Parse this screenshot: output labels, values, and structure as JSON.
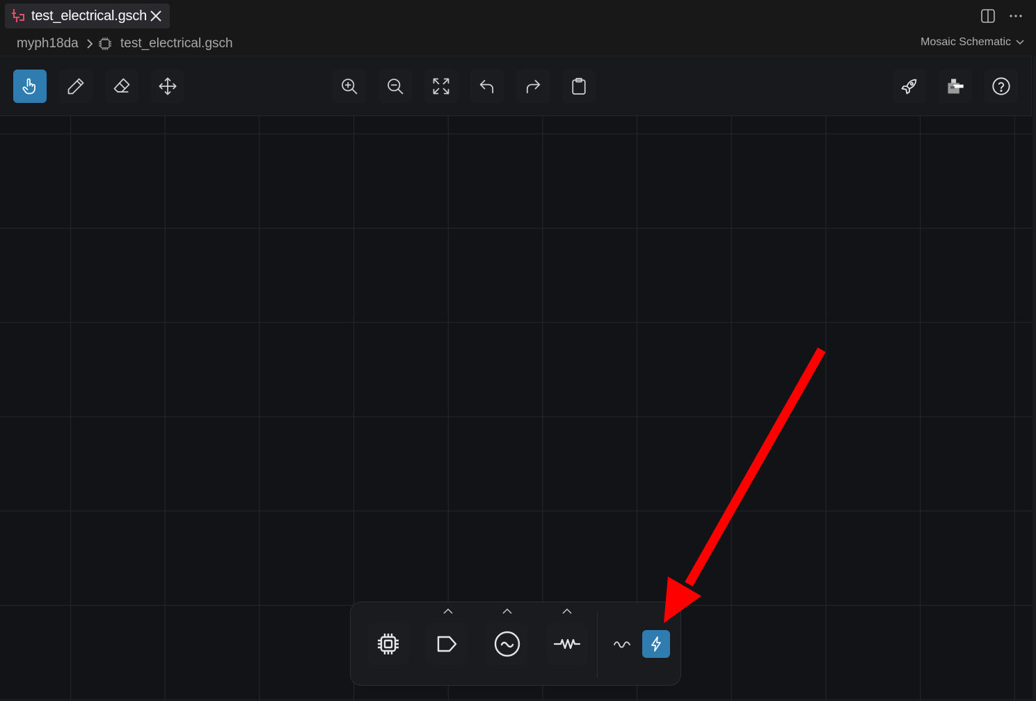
{
  "tab": {
    "title": "test_electrical.gsch",
    "icon": "schematic-icon",
    "accent": "#e0506a"
  },
  "breadcrumb": {
    "project": "myph18da",
    "file": "test_electrical.gsch"
  },
  "editor": {
    "mode_label": "Mosaic Schematic"
  },
  "toolbar": {
    "left": [
      {
        "name": "pointer-tool",
        "icon": "hand-pointer-icon",
        "active": true
      },
      {
        "name": "draw-tool",
        "icon": "pencil-icon",
        "active": false
      },
      {
        "name": "erase-tool",
        "icon": "eraser-icon",
        "active": false
      },
      {
        "name": "move-tool",
        "icon": "move-arrows-icon",
        "active": false
      }
    ],
    "center": [
      {
        "name": "zoom-in",
        "icon": "zoom-in-icon"
      },
      {
        "name": "zoom-out",
        "icon": "zoom-out-icon"
      },
      {
        "name": "fit-view",
        "icon": "fit-screen-icon"
      },
      {
        "name": "undo",
        "icon": "undo-icon"
      },
      {
        "name": "redo",
        "icon": "redo-icon"
      },
      {
        "name": "clipboard",
        "icon": "clipboard-icon"
      }
    ],
    "right": [
      {
        "name": "run",
        "icon": "rocket-icon"
      },
      {
        "name": "export",
        "icon": "export-icon"
      },
      {
        "name": "help",
        "icon": "help-circle-icon"
      }
    ]
  },
  "dock": {
    "items": [
      {
        "name": "chip-component",
        "icon": "chip-icon",
        "has_menu": false
      },
      {
        "name": "port-component",
        "icon": "port-tag-icon",
        "has_menu": true
      },
      {
        "name": "source-component",
        "icon": "ac-source-icon",
        "has_menu": true
      },
      {
        "name": "resistor-component",
        "icon": "resistor-icon",
        "has_menu": true
      }
    ],
    "mode_toggle": [
      {
        "name": "analog-mode",
        "icon": "sine-wave-icon",
        "active": false
      },
      {
        "name": "electrical-mode",
        "icon": "lightning-icon",
        "active": true
      }
    ]
  },
  "colors": {
    "accent": "#2e7cb0",
    "annotation_arrow": "#ff0000",
    "canvas": "#121316"
  }
}
